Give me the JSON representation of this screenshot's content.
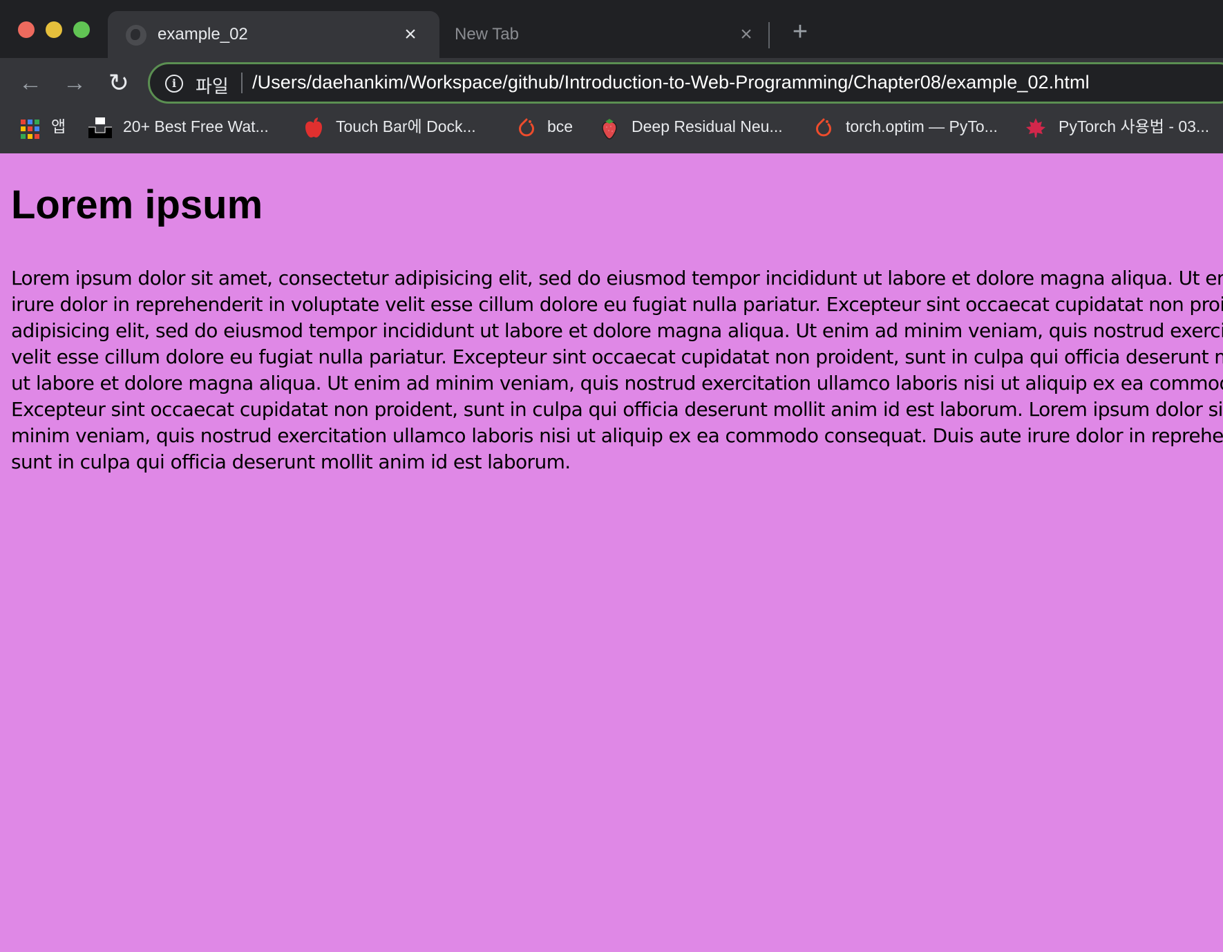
{
  "tabs": [
    {
      "title": "example_02",
      "active": true
    },
    {
      "title": "New Tab",
      "active": false
    }
  ],
  "new_tab_label": "+",
  "nav": {
    "back": "←",
    "forward": "→",
    "reload": "↻"
  },
  "omnibox": {
    "scheme_label": "파일",
    "url": "/Users/daehankim/Workspace/github/Introduction-to-Web-Programming/Chapter08/example_02.html"
  },
  "bookmarks": [
    {
      "label": "앱",
      "icon": "apps-grid-icon"
    },
    {
      "label": "20+ Best Free Wat...",
      "icon": "unsplash-icon"
    },
    {
      "label": "Touch Bar에 Dock...",
      "icon": "apple-icon"
    },
    {
      "label": "bce",
      "icon": "pytorch-icon"
    },
    {
      "label": "Deep Residual Neu...",
      "icon": "strawberry-icon"
    },
    {
      "label": "torch.optim — PyTo...",
      "icon": "pytorch-icon"
    },
    {
      "label": "PyTorch 사용법 - 03...",
      "icon": "maple-leaf-icon"
    }
  ],
  "colors": {
    "page_background": "#df88e6",
    "omnibox_border": "#5b8f52"
  },
  "page": {
    "heading": "Lorem ipsum",
    "paragraph_lines": [
      "Lorem ipsum dolor sit amet, consectetur adipisicing elit, sed do eiusmod tempor incididunt ut labore et dolore magna aliqua. Ut en",
      "irure dolor in reprehenderit in voluptate velit esse cillum dolore eu fugiat nulla pariatur. Excepteur sint occaecat cupidatat non proi",
      "adipisicing elit, sed do eiusmod tempor incididunt ut labore et dolore magna aliqua. Ut enim ad minim veniam, quis nostrud exercit",
      "velit esse cillum dolore eu fugiat nulla pariatur. Excepteur sint occaecat cupidatat non proident, sunt in culpa qui officia deserunt m",
      "ut labore et dolore magna aliqua. Ut enim ad minim veniam, quis nostrud exercitation ullamco laboris nisi ut aliquip ex ea commodo",
      "Excepteur sint occaecat cupidatat non proident, sunt in culpa qui officia deserunt mollit anim id est laborum. Lorem ipsum dolor sit",
      "minim veniam, quis nostrud exercitation ullamco laboris nisi ut aliquip ex ea commodo consequat. Duis aute irure dolor in reprehen",
      "sunt in culpa qui officia deserunt mollit anim id est laborum."
    ]
  }
}
